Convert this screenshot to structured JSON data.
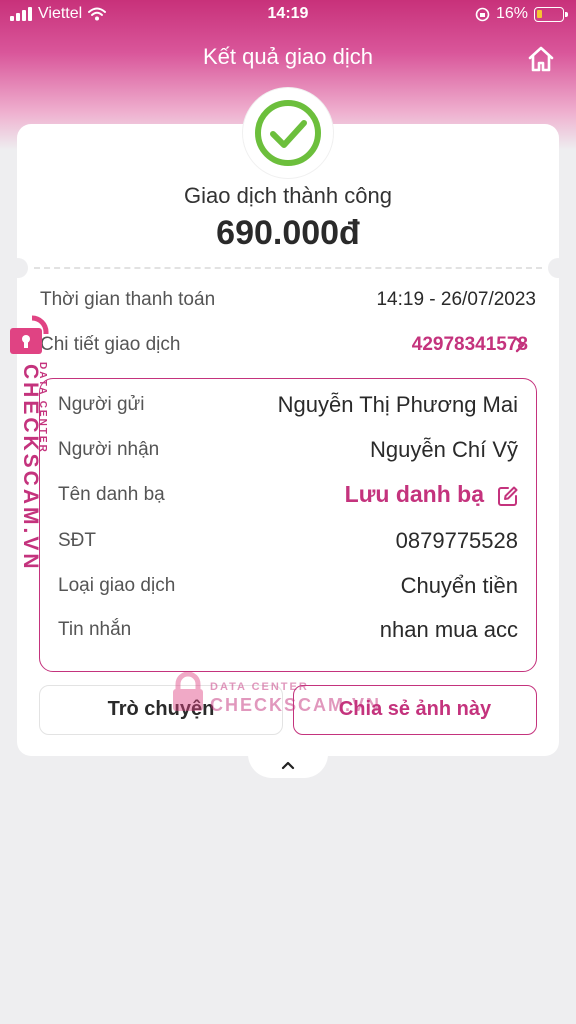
{
  "status_bar": {
    "carrier": "Viettel",
    "time": "14:19",
    "battery": "16%",
    "battery_color": "#f5c431"
  },
  "header": {
    "title": "Kết quả giao dịch",
    "home_icon": "home-icon"
  },
  "result": {
    "status_text": "Giao dịch thành công",
    "amount": "690.000đ",
    "success_icon": "check-circle-icon",
    "success_color": "#6cbf3c"
  },
  "summary": {
    "time_label": "Thời gian thanh toán",
    "time_value": "14:19 - 26/07/2023",
    "txn_label": "Chi tiết giao dịch",
    "txn_id": "42978341578"
  },
  "details": [
    {
      "label": "Người gửi",
      "value": "Nguyễn Thị Phương Mai"
    },
    {
      "label": "Người nhận",
      "value": "Nguyễn Chí Vỹ"
    },
    {
      "label": "Tên danh bạ",
      "value": "Lưu danh bạ"
    },
    {
      "label": "SĐT",
      "value": "0879775528"
    },
    {
      "label": "Loại giao dịch",
      "value": "Chuyển tiền"
    },
    {
      "label": "Tin nhắn",
      "value": "nhan mua acc"
    }
  ],
  "actions": {
    "chat_label": "Trò chuyện",
    "share_label": "Chia sẻ ảnh này"
  },
  "watermark": {
    "small": "DATA CENTER",
    "big": "CHECKSCAM.VN"
  },
  "colors": {
    "brand": "#c4337d",
    "header_gradient_top": "#c8317a"
  }
}
